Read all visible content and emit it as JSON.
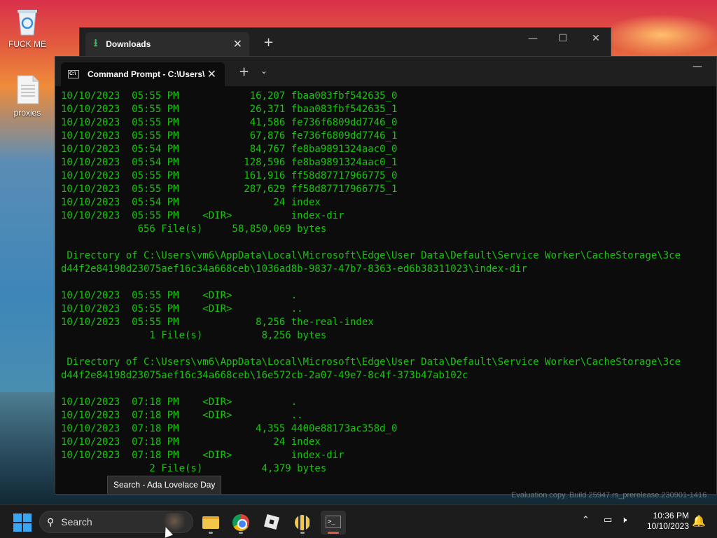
{
  "desktop": {
    "icons": [
      {
        "label": "FUCK ME",
        "icon": "recycle-bin-icon"
      },
      {
        "label": "proxies",
        "icon": "text-file-icon"
      }
    ]
  },
  "downloads_window": {
    "tab_title": "Downloads"
  },
  "terminal": {
    "tab_title": "Command Prompt - C:\\Users\\",
    "lines": [
      "10/10/2023  05:55 PM            16,207 fbaa083fbf542635_0",
      "10/10/2023  05:55 PM            26,371 fbaa083fbf542635_1",
      "10/10/2023  05:55 PM            41,586 fe736f6809dd7746_0",
      "10/10/2023  05:55 PM            67,876 fe736f6809dd7746_1",
      "10/10/2023  05:54 PM            84,767 fe8ba9891324aac0_0",
      "10/10/2023  05:54 PM           128,596 fe8ba9891324aac0_1",
      "10/10/2023  05:55 PM           161,916 ff58d87717966775_0",
      "10/10/2023  05:55 PM           287,629 ff58d87717966775_1",
      "10/10/2023  05:54 PM                24 index",
      "10/10/2023  05:55 PM    <DIR>          index-dir",
      "             656 File(s)     58,850,069 bytes",
      "",
      " Directory of C:\\Users\\vm6\\AppData\\Local\\Microsoft\\Edge\\User Data\\Default\\Service Worker\\CacheStorage\\3ce",
      "d44f2e84198d23075aef16c34a668ceb\\1036ad8b-9837-47b7-8363-ed6b38311023\\index-dir",
      "",
      "10/10/2023  05:55 PM    <DIR>          .",
      "10/10/2023  05:55 PM    <DIR>          ..",
      "10/10/2023  05:55 PM             8,256 the-real-index",
      "               1 File(s)          8,256 bytes",
      "",
      " Directory of C:\\Users\\vm6\\AppData\\Local\\Microsoft\\Edge\\User Data\\Default\\Service Worker\\CacheStorage\\3ce",
      "d44f2e84198d23075aef16c34a668ceb\\16e572cb-2a07-49e7-8c4f-373b47ab102c",
      "",
      "10/10/2023  07:18 PM    <DIR>          .",
      "10/10/2023  07:18 PM    <DIR>          ..",
      "10/10/2023  07:18 PM             4,355 4400e88173ac358d_0",
      "10/10/2023  07:18 PM                24 index",
      "10/10/2023  07:18 PM    <DIR>          index-dir",
      "               2 File(s)          4,379 bytes"
    ]
  },
  "tooltip": "Search - Ada Lovelace Day",
  "watermark": "Evaluation copy. Build 25947.rs_prerelease.230901-1416",
  "taskbar": {
    "search_placeholder": "Search",
    "apps": [
      "File Explorer",
      "Google Chrome",
      "Roblox",
      "Bee app",
      "Terminal"
    ],
    "time": "10:36 PM",
    "date": "10/10/2023"
  },
  "colors": {
    "terminal_text": "#16c60c",
    "accent": "#39a5f5"
  }
}
